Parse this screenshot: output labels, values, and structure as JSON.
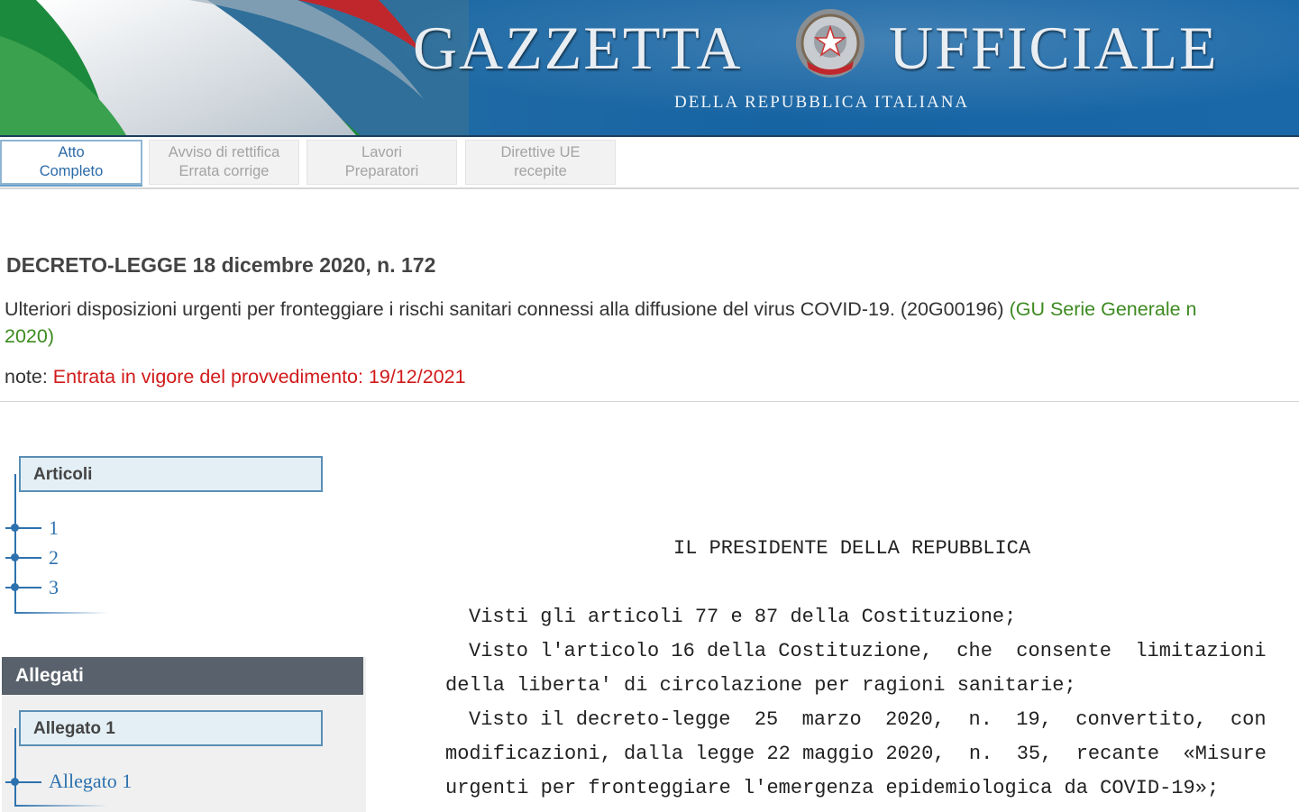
{
  "header": {
    "title_left": "GAZZETTA",
    "title_right": "UFFICIALE",
    "subtitle": "DELLA REPUBBLICA ITALIANA",
    "emblem_text": "REPUBBLICA ITALIANA"
  },
  "tabs": [
    {
      "label": "Atto\nCompleto",
      "active": true
    },
    {
      "label": "Avviso di rettifica\nErrata corrige",
      "active": false
    },
    {
      "label": "Lavori\nPreparatori",
      "active": false
    },
    {
      "label": "Direttive UE\nrecepite",
      "active": false
    }
  ],
  "document": {
    "title": "DECRETO-LEGGE 18 dicembre 2020, n. 172",
    "subtitle": "Ulteriori disposizioni urgenti per fronteggiare i rischi sanitari connessi alla diffusione del virus COVID-19. (20G00196) ",
    "gu_link_part1": "(GU Serie Generale n",
    "gu_link_part2": "2020)",
    "note_label": "note: ",
    "note_value": "Entrata in vigore del provvedimento: 19/12/2021"
  },
  "sidebar": {
    "articoli_label": "Articoli",
    "articoli": [
      "1",
      "2",
      "3"
    ],
    "allegati_header": "Allegati",
    "allegato_box_label": "Allegato 1",
    "allegati_items": [
      "Allegato 1"
    ]
  },
  "body_text": {
    "heading": "IL PRESIDENTE DELLA REPUBBLICA",
    "lines": [
      "Visti gli articoli 77 e 87 della Costituzione;",
      "Visto l'articolo 16 della Costituzione,  che  consente  limitazioni",
      "della liberta' di circolazione per ragioni sanitarie;",
      "Visto il decreto-legge  25  marzo  2020,  n.  19,  convertito,  con",
      "modificazioni, dalla legge 22 maggio 2020,  n.  35,  recante  «Misure",
      "urgenti per fronteggiare l'emergenza epidemiologica da COVID-19»;"
    ]
  },
  "colors": {
    "banner_blue": "#1f6aa5",
    "link_blue": "#2d72ae",
    "gu_green": "#3d8a20",
    "note_red": "#d11a1a",
    "allegati_header_bg": "#58616c"
  }
}
